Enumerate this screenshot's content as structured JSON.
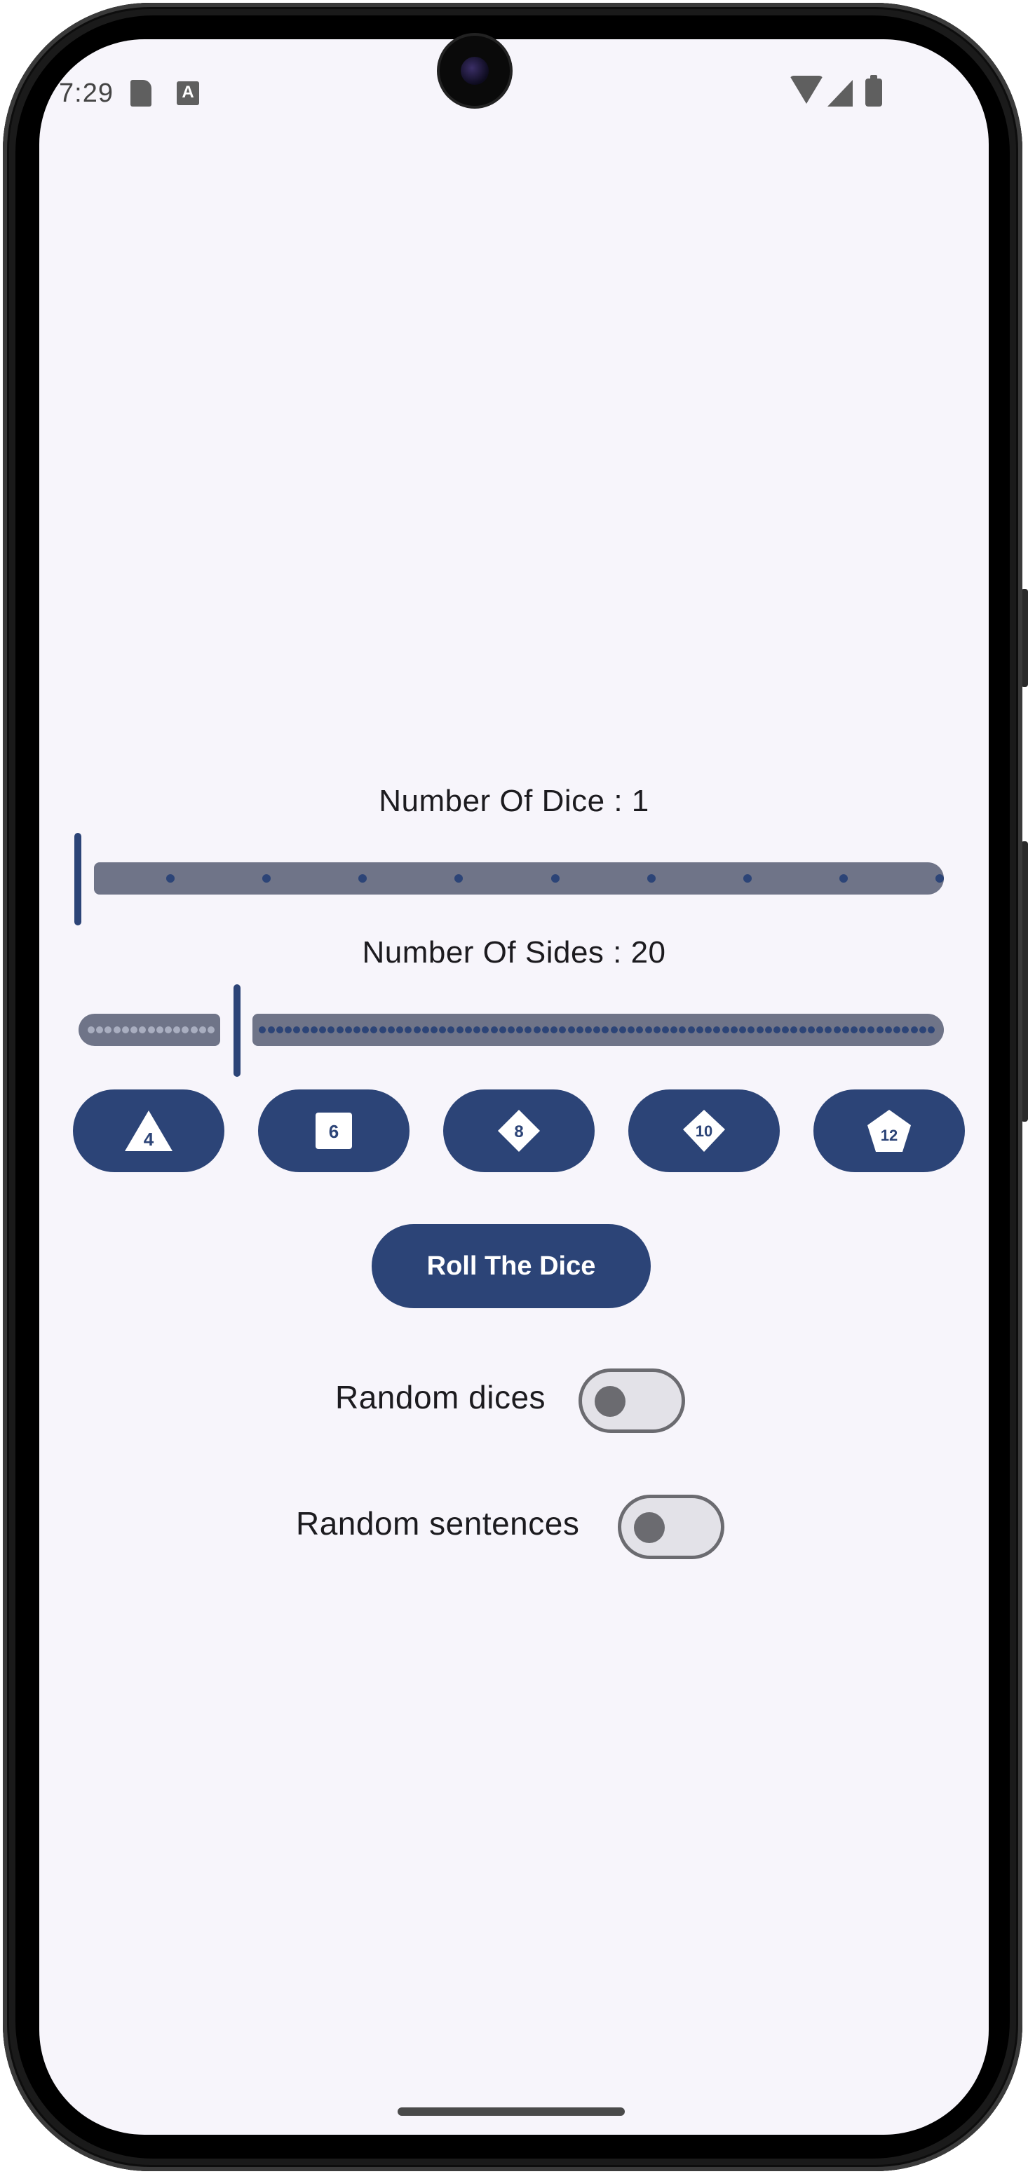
{
  "status_bar": {
    "time": "7:29",
    "a_icon_glyph": "A",
    "icons": [
      "sd-card-icon",
      "a-text-icon",
      "wifi-icon",
      "signal-icon",
      "battery-icon"
    ]
  },
  "dice_count": {
    "label": "Number Of Dice : 1",
    "value": 1,
    "min": 1,
    "max": 10
  },
  "sides": {
    "label": "Number Of Sides : 20",
    "value": 20,
    "min": 2,
    "max": 100
  },
  "presets": [
    {
      "label": "4",
      "shape": "triangle"
    },
    {
      "label": "6",
      "shape": "square"
    },
    {
      "label": "8",
      "shape": "diamond"
    },
    {
      "label": "10",
      "shape": "diamond"
    },
    {
      "label": "12",
      "shape": "pentagon"
    }
  ],
  "roll_button": {
    "label": "Roll The Dice"
  },
  "toggles": {
    "random_dices": {
      "label": "Random dices",
      "on": false
    },
    "random_sentences": {
      "label": "Random sentences",
      "on": false
    }
  },
  "colors": {
    "primary": "#2c4477",
    "track": "#6f7488",
    "background": "#f7f5fb"
  }
}
